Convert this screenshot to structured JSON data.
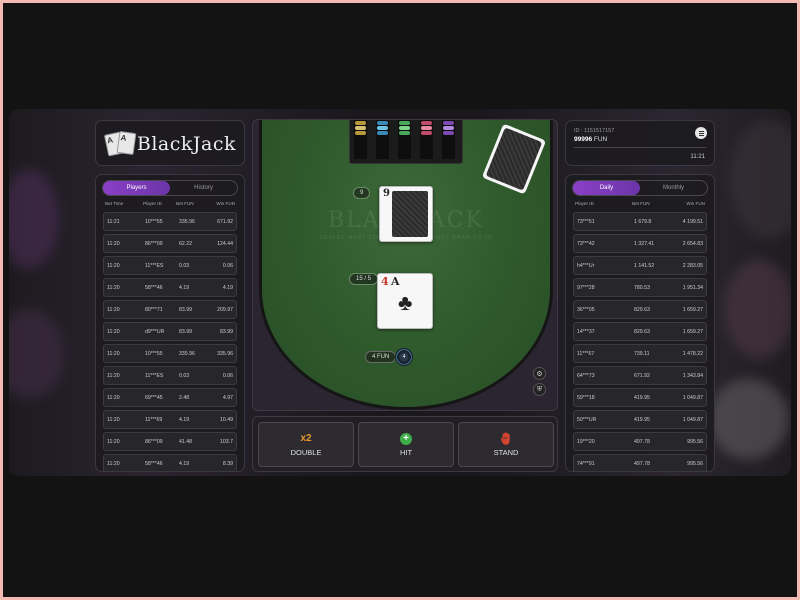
{
  "logo": {
    "text": "BlackJack",
    "card1": "A",
    "card2": "A"
  },
  "left_panel": {
    "tabs": [
      {
        "label": "Players",
        "active": true
      },
      {
        "label": "History",
        "active": false
      }
    ],
    "columns": [
      "Bet Time",
      "Player ID",
      "Bet  FUN",
      "Win  FUN"
    ],
    "rows": [
      [
        "11:21",
        "10***55",
        "335.96",
        "671.92"
      ],
      [
        "11:20",
        "86***09",
        "62.22",
        "124.44"
      ],
      [
        "11:20",
        "11***ES",
        "0.03",
        "0.06"
      ],
      [
        "11:20",
        "58***46",
        "4.19",
        "4.19"
      ],
      [
        "11:20",
        "80***71",
        "83.99",
        "209.97"
      ],
      [
        "11:20",
        "d9***UR",
        "83.99",
        "83.99"
      ],
      [
        "11:20",
        "10***55",
        "335.96",
        "335.96"
      ],
      [
        "11:20",
        "11***ES",
        "0.03",
        "0.06"
      ],
      [
        "11:20",
        "69***45",
        "2.48",
        "4.97"
      ],
      [
        "11:20",
        "11***69",
        "4.19",
        "10.49"
      ],
      [
        "11:20",
        "86***09",
        "41.48",
        "103.7"
      ],
      [
        "11:20",
        "58***46",
        "4.19",
        "8.39"
      ]
    ]
  },
  "info": {
    "id_label": "ID : 1151517157",
    "balance": "99996",
    "currency": "FUN",
    "time": "11:21"
  },
  "right_panel": {
    "tabs": [
      {
        "label": "Daily",
        "active": true
      },
      {
        "label": "Monthly",
        "active": false
      }
    ],
    "columns": [
      "Player ID",
      "Bet  FUN",
      "Win  FUN"
    ],
    "rows": [
      [
        "73***51",
        "1 679.8",
        "4 199.51"
      ],
      [
        "73***42",
        "1 327.41",
        "2 654.83"
      ],
      [
        "h4***Ur",
        "1 141.52",
        "2 283.05"
      ],
      [
        "97***28",
        "780.53",
        "1 951.34"
      ],
      [
        "36***05",
        "829.63",
        "1 659.27"
      ],
      [
        "14***37",
        "829.63",
        "1 659.27"
      ],
      [
        "11***67",
        "739.11",
        "1 478.22"
      ],
      [
        "64***73",
        "671.92",
        "1 343.84"
      ],
      [
        "59***18",
        "419.95",
        "1 049.87"
      ],
      [
        "50***UR",
        "419.95",
        "1 049.87"
      ],
      [
        "19***20",
        "497.78",
        "995.56"
      ],
      [
        "74***91",
        "497.78",
        "995.56"
      ]
    ]
  },
  "table": {
    "felt_title": "BLACKJACK",
    "felt_rule": "DEALER MUST STAND TO 17, AND MUST DRAW TO 16",
    "dealer_score": "9",
    "dealer_card_rank": "9",
    "player_score": "15 / 5",
    "player_card1_rank": "4",
    "player_card2_rank": "A",
    "player_card2_suit": "♣",
    "bet_amount": "4",
    "bet_currency": "FUN",
    "chip_value": "4"
  },
  "actions": {
    "double_label": "DOUBLE",
    "double_icon": "x2",
    "hit_label": "HIT",
    "hit_icon": "+",
    "stand_label": "STAND"
  },
  "colors": {
    "accent_purple": "#8a3fc6",
    "felt_green": "#2f5a2c",
    "hit_green": "#3fae4a",
    "double_orange": "#e8962e",
    "stand_red": "#d0452f"
  }
}
